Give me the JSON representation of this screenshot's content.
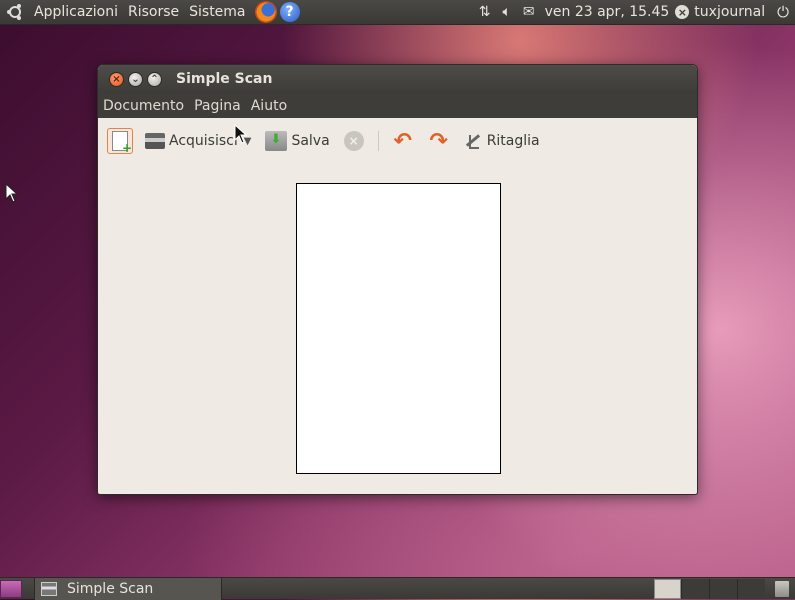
{
  "top_panel": {
    "menus": [
      "Applicazioni",
      "Risorse",
      "Sistema"
    ],
    "clock": "ven 23 apr, 15.45",
    "username": "tuxjournal"
  },
  "window": {
    "title": "Simple Scan",
    "menu": [
      "Documento",
      "Pagina",
      "Aiuto"
    ],
    "toolbar": {
      "scan_label": "Acquisisci",
      "save_label": "Salva",
      "crop_label": "Ritaglia"
    }
  },
  "taskbar": {
    "task_label": "Simple Scan"
  },
  "icons": {
    "new-document": "new-document-icon",
    "scanner": "scanner-icon",
    "save": "save-icon",
    "stop": "stop-icon",
    "rotate-left": "rotate-left-icon",
    "rotate-right": "rotate-right-icon",
    "crop": "crop-icon"
  },
  "colors": {
    "panel": "#3c3b37",
    "window_bg": "#efebe4",
    "accent": "#e2571d"
  }
}
